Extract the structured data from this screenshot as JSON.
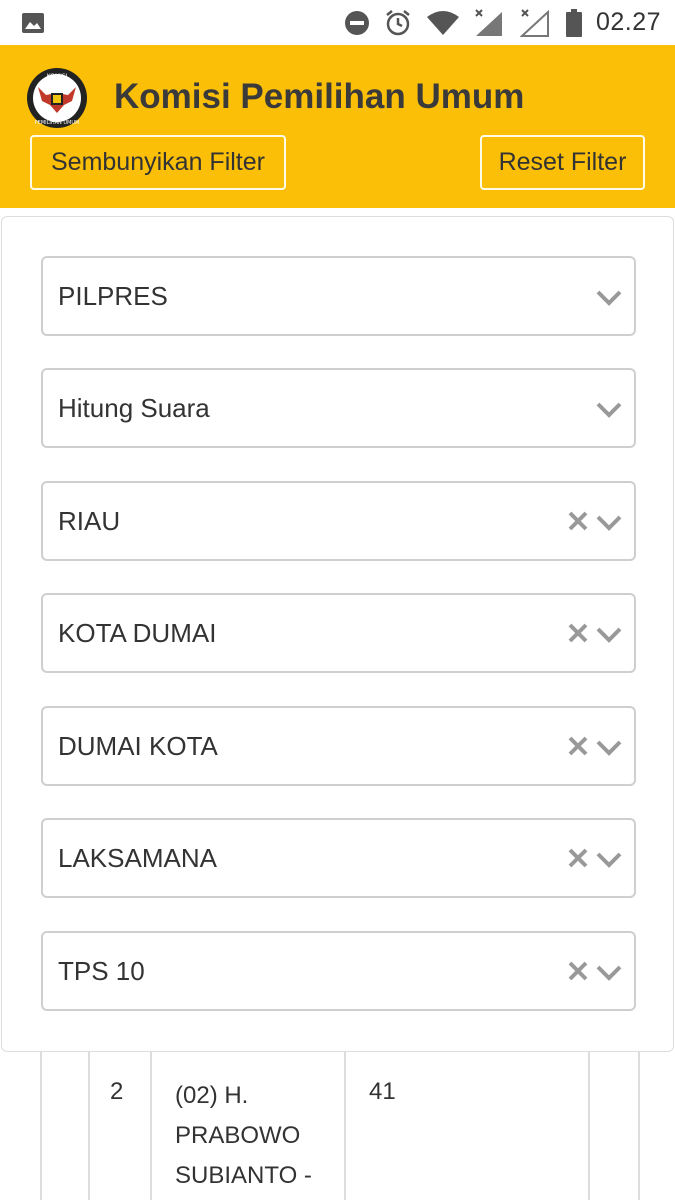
{
  "status_bar": {
    "time": "02.27",
    "icons": [
      "image-icon",
      "do-not-disturb-icon",
      "alarm-icon",
      "wifi-icon",
      "signal-x-icon",
      "signal-x-icon",
      "battery-icon"
    ]
  },
  "header": {
    "logo_text": "KOMISI PEMILIHAN UMUM",
    "title": "Komisi Pemilihan Umum",
    "hide_filter_label": "Sembunyikan Filter",
    "reset_filter_label": "Reset Filter",
    "accent_color": "#fbbf07"
  },
  "filters": [
    {
      "value": "PILPRES",
      "clearable": false
    },
    {
      "value": "Hitung Suara",
      "clearable": false
    },
    {
      "value": "RIAU",
      "clearable": true
    },
    {
      "value": "KOTA DUMAI",
      "clearable": true
    },
    {
      "value": "DUMAI KOTA",
      "clearable": true
    },
    {
      "value": "LAKSAMANA",
      "clearable": true
    },
    {
      "value": "TPS 10",
      "clearable": true
    }
  ],
  "table": {
    "row": {
      "no": "2",
      "candidate": "(02) H. PRABOWO SUBIANTO -",
      "votes": "41"
    }
  }
}
